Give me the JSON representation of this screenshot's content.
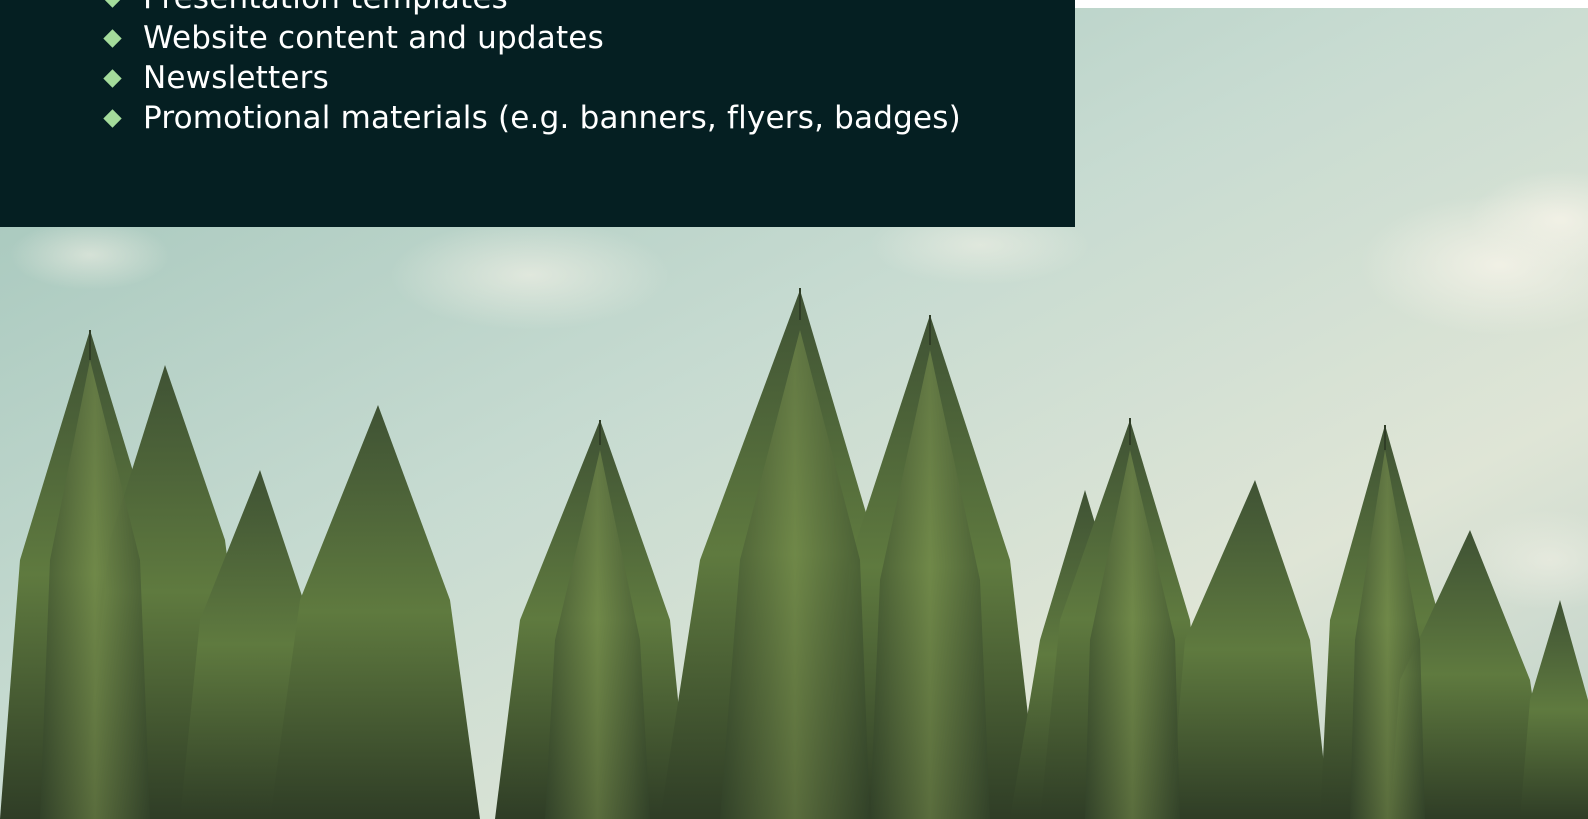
{
  "services_list": {
    "items": [
      {
        "label": "Presentation templates"
      },
      {
        "label": "Website content and updates"
      },
      {
        "label": "Newsletters"
      },
      {
        "label": "Promotional materials (e.g. banners, flyers, badges)"
      }
    ],
    "bullet_icon": "diamond-bullet-icon"
  },
  "colors": {
    "panel_background": "#051f22",
    "bullet": "#a4dc9b",
    "text": "#ffffff",
    "sky": "#b9d3c9",
    "tree_dark": "#2c3a25",
    "tree_light": "#7d9450"
  },
  "background_image": {
    "subject": "spruce-treeline-sky-photo"
  }
}
